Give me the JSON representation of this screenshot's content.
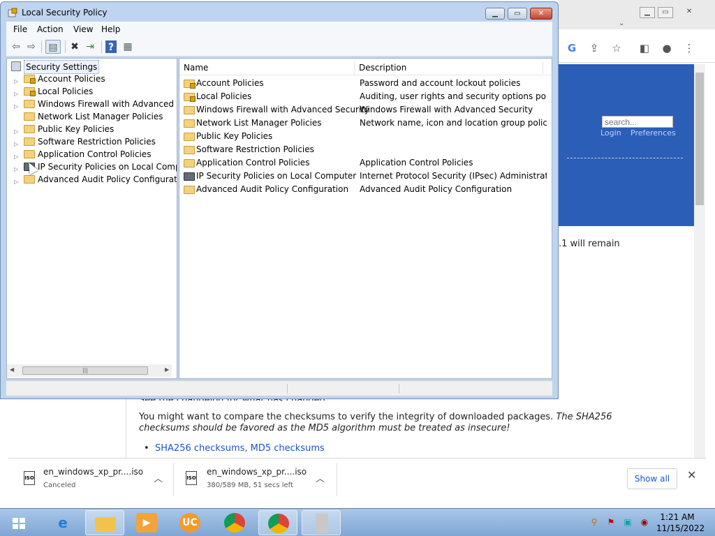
{
  "window": {
    "title": "Local Security Policy",
    "menu": [
      "File",
      "Action",
      "View",
      "Help"
    ]
  },
  "tree": {
    "root": "Security Settings",
    "items": [
      {
        "label": "Account Policies",
        "icon": "lock-folder-icon",
        "expandable": true
      },
      {
        "label": "Local Policies",
        "icon": "lock-folder-icon",
        "expandable": true
      },
      {
        "label": "Windows Firewall with Advanced Security",
        "icon": "folder-icon",
        "expandable": true
      },
      {
        "label": "Network List Manager Policies",
        "icon": "folder-icon",
        "expandable": false
      },
      {
        "label": "Public Key Policies",
        "icon": "folder-icon",
        "expandable": true
      },
      {
        "label": "Software Restriction Policies",
        "icon": "folder-icon",
        "expandable": true
      },
      {
        "label": "Application Control Policies",
        "icon": "folder-icon",
        "expandable": true
      },
      {
        "label": "IP Security Policies on Local Computer",
        "icon": "ip-security-icon",
        "expandable": true
      },
      {
        "label": "Advanced Audit Policy Configuration",
        "icon": "folder-icon",
        "expandable": true
      }
    ]
  },
  "list": {
    "columns": [
      "Name",
      "Description"
    ],
    "rows": [
      {
        "name": "Account Policies",
        "description": "Password and account lockout policies",
        "icon": "lock-folder-icon"
      },
      {
        "name": "Local Policies",
        "description": "Auditing, user rights and security options polici...",
        "icon": "lock-folder-icon"
      },
      {
        "name": "Windows Firewall with Advanced Security",
        "description": "Windows Firewall with Advanced Security",
        "icon": "folder-icon"
      },
      {
        "name": "Network List Manager Policies",
        "description": "Network name, icon and location group policies.",
        "icon": "folder-icon"
      },
      {
        "name": "Public Key Policies",
        "description": "",
        "icon": "folder-icon"
      },
      {
        "name": "Software Restriction Policies",
        "description": "",
        "icon": "folder-icon"
      },
      {
        "name": "Application Control Policies",
        "description": "Application Control Policies",
        "icon": "folder-icon"
      },
      {
        "name": "IP Security Policies on Local Computer",
        "description": "Internet Protocol Security (IPsec) Administratio...",
        "icon": "ip-security-icon"
      },
      {
        "name": "Advanced Audit Policy Configuration",
        "description": "Advanced Audit Policy Configuration",
        "icon": "folder-icon"
      }
    ]
  },
  "browser": {
    "search_placeholder": "search...",
    "login": "Login",
    "preferences": "Preferences",
    "snippet": ".1 will remain",
    "para_cut": "See the changelog for what has changed.",
    "para_1": "You might want to compare the checksums to verify the integrity of downloaded packages.",
    "para_1_italic": "The SHA256",
    "para_2_italic": "checksums should be favored as the MD5 algorithm must be treated as insecure!",
    "bullet_link_1": "SHA256 checksums",
    "bullet_sep": ", ",
    "bullet_link_2": "MD5 checksums"
  },
  "downloads": {
    "items": [
      {
        "name": "en_windows_xp_pr....iso",
        "status": "Canceled"
      },
      {
        "name": "en_windows_xp_pr....iso",
        "status": "380/589 MB, 51 secs left"
      }
    ],
    "show_all": "Show all"
  },
  "taskbar": {
    "time": "1:21 AM",
    "date": "11/15/2022"
  },
  "colors": {
    "desktop": "#3a6ea5",
    "link": "#1a55c8",
    "window_frame": "#bfd4ee"
  }
}
